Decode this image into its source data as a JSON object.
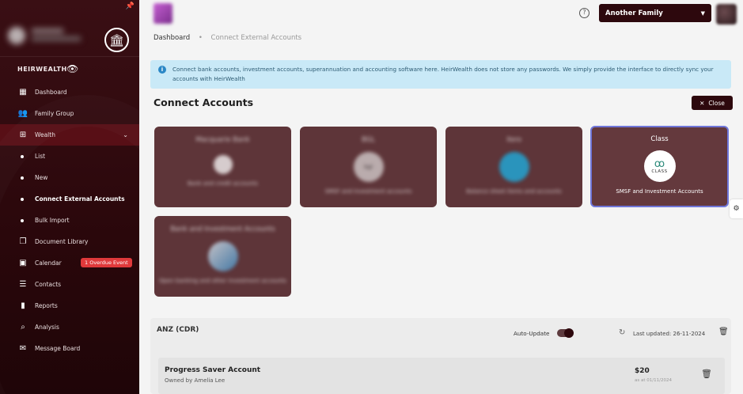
{
  "sidebar": {
    "brand": "HEIRWEALTH",
    "items": [
      {
        "label": "Dashboard",
        "icon": "dashboard-icon"
      },
      {
        "label": "Family Group",
        "icon": "people-icon"
      },
      {
        "label": "Wealth",
        "icon": "grid-icon"
      },
      {
        "label": "List"
      },
      {
        "label": "New"
      },
      {
        "label": "Connect External Accounts"
      },
      {
        "label": "Bulk Import"
      },
      {
        "label": "Document Library",
        "icon": "library-icon"
      },
      {
        "label": "Calendar",
        "icon": "calendar-icon",
        "badge": "1 Overdue Event"
      },
      {
        "label": "Contacts",
        "icon": "contacts-icon"
      },
      {
        "label": "Reports",
        "icon": "bar-chart-icon"
      },
      {
        "label": "Analysis",
        "icon": "analysis-icon"
      },
      {
        "label": "Message Board",
        "icon": "chat-icon"
      }
    ]
  },
  "header": {
    "family_select": "Another Family"
  },
  "breadcrumb": {
    "root": "Dashboard",
    "current": "Connect External Accounts"
  },
  "info_text": "Connect bank accounts, investment accounts, superannuation and accounting software here. HeirWealth does not store any passwords. We simply provide the interface to directly sync your accounts with HeirWealth",
  "page_title": "Connect Accounts",
  "close_label": "Close",
  "providers": [
    {
      "title": "Macquarie Bank",
      "desc": "Bank and credit accounts",
      "blurred": true
    },
    {
      "title": "BGL",
      "desc": "SMSF and investment accounts",
      "blurred": true
    },
    {
      "title": "Xero",
      "desc": "Balance sheet items and accounts",
      "blurred": true
    },
    {
      "title": "Class",
      "desc": "SMSF and Investment Accounts",
      "blurred": false
    },
    {
      "title": "Bank and Investment Accounts",
      "desc": "Open banking and other investment accounts",
      "blurred": true
    }
  ],
  "class_logo_text": "CLASS",
  "connection": {
    "name": "ANZ (CDR)",
    "auto_update_label": "Auto-Update",
    "auto_update_on": true,
    "last_updated": "Last updated: 26-11-2024",
    "account": {
      "name": "Progress Saver Account",
      "owner": "Owned by Amelia Lee",
      "amount": "$20",
      "as_of": "as at 01/11/2024"
    }
  },
  "colors": {
    "sidebar_bg": "#2a070b",
    "accent": "#2d080d",
    "card_bg": "#5e3539",
    "info_bg": "#c9e9f7",
    "badge": "#e0393b",
    "selected_border": "#6f76d9"
  }
}
